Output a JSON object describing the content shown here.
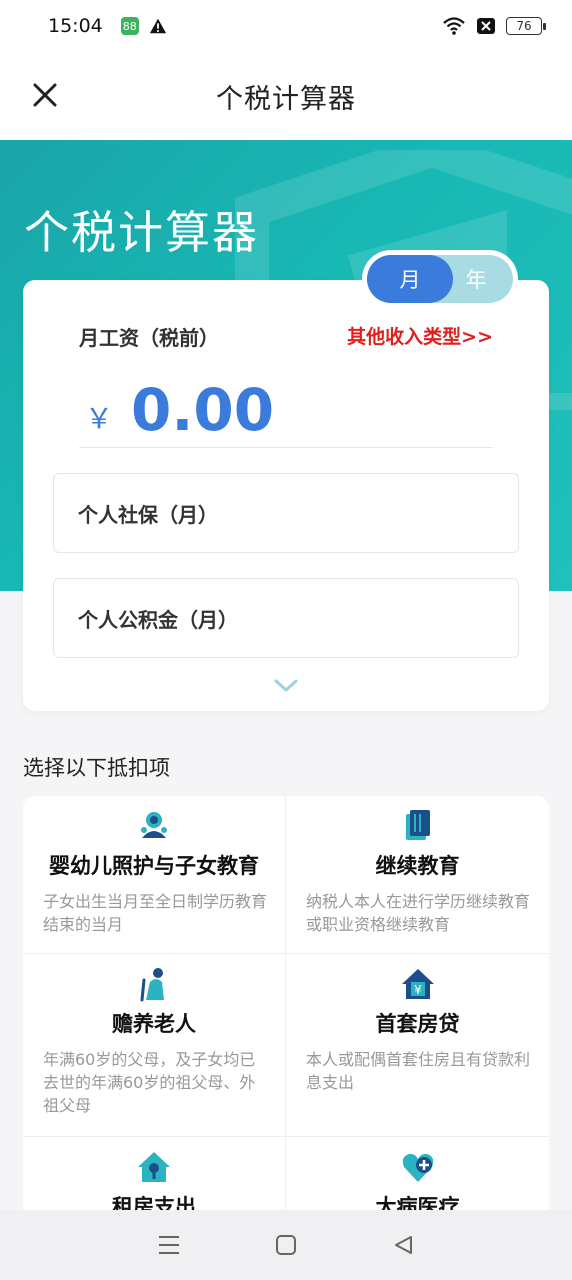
{
  "status": {
    "time": "15:04",
    "battery": "76",
    "app_badge": "88"
  },
  "header": {
    "title": "个税计算器"
  },
  "hero": {
    "title": "个税计算器"
  },
  "toggle": {
    "month": "月",
    "year": "年"
  },
  "calc": {
    "salary_label": "月工资（税前）",
    "other_income": "其他收入类型>>",
    "currency": "￥",
    "salary_value": "0.00",
    "social_security": "个人社保（月）",
    "housing_fund": "个人公积金（月）"
  },
  "deductions": {
    "section_title": "选择以下抵扣项",
    "items": [
      {
        "title": "婴幼儿照护与子女教育",
        "desc": "子女出生当月至全日制学历教育结束的当月",
        "icon": "child-education-icon"
      },
      {
        "title": "继续教育",
        "desc": "纳税人本人在进行学历继续教育或职业资格继续教育",
        "icon": "book-icon"
      },
      {
        "title": "赡养老人",
        "desc": "年满60岁的父母，及子女均已去世的年满60岁的祖父母、外祖父母",
        "icon": "elderly-icon"
      },
      {
        "title": "首套房贷",
        "desc": "本人或配偶首套住房且有贷款利息支出",
        "icon": "house-loan-icon"
      },
      {
        "title": "租房支出",
        "desc": "",
        "icon": "rent-house-icon"
      },
      {
        "title": "大病医疗",
        "desc": "",
        "icon": "medical-heart-icon"
      }
    ]
  },
  "colors": {
    "accent": "#3a7bdb",
    "teal": "#1aa5a8",
    "red": "#e0201f"
  }
}
